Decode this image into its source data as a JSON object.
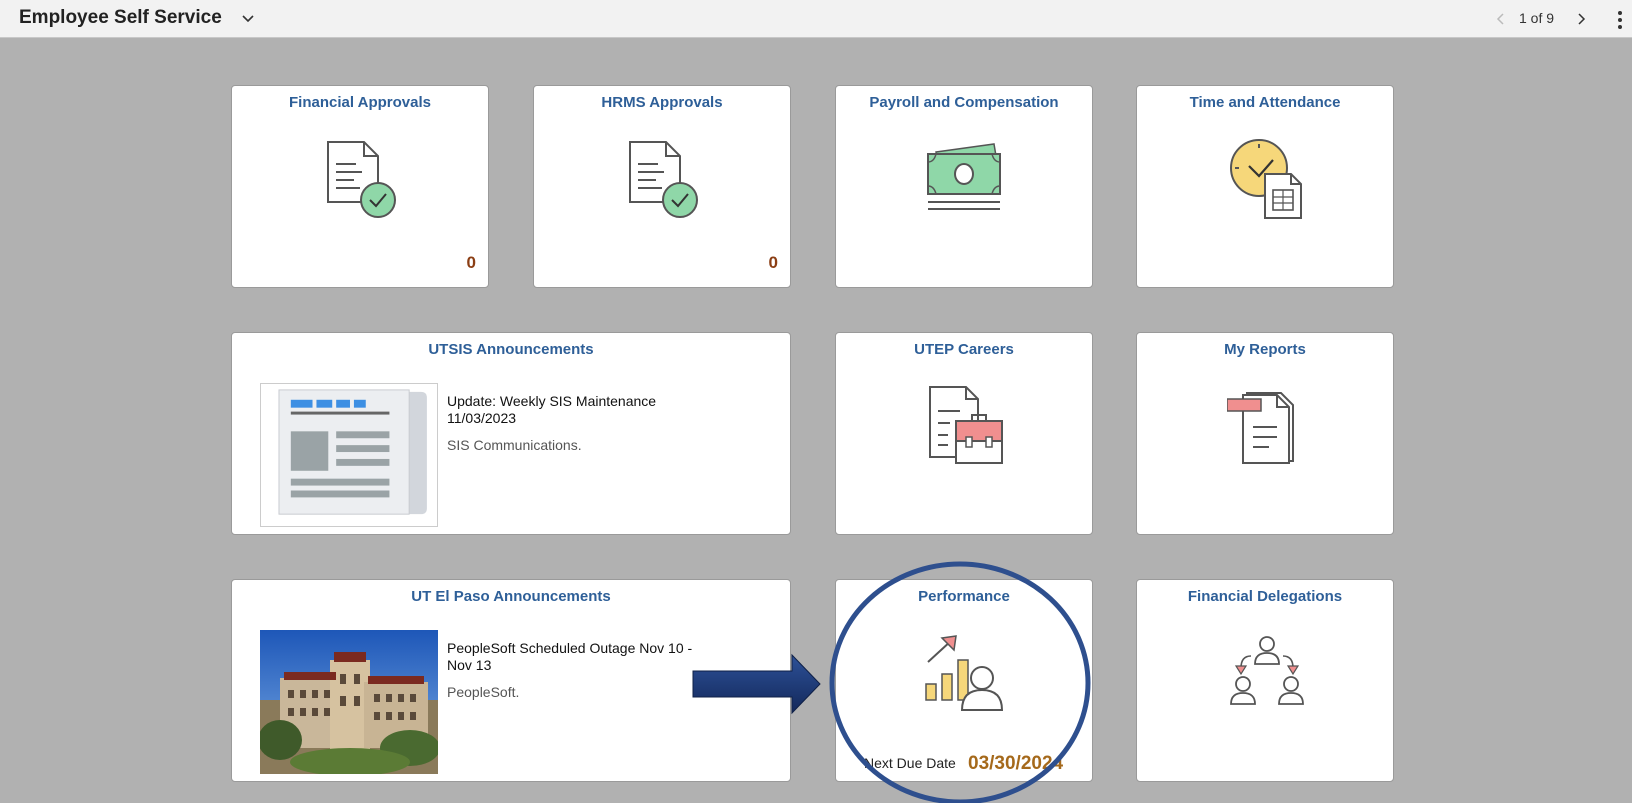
{
  "header": {
    "title": "Employee Self Service",
    "pager": "1 of 9"
  },
  "tiles": {
    "financial_approvals": {
      "title": "Financial Approvals",
      "count": "0"
    },
    "hrms_approvals": {
      "title": "HRMS Approvals",
      "count": "0"
    },
    "payroll": {
      "title": "Payroll and Compensation"
    },
    "time_attendance": {
      "title": "Time and Attendance"
    },
    "utsis": {
      "title": "UTSIS Announcements",
      "news_title": "Update: Weekly SIS Maintenance 11/03/2023",
      "news_sub": "SIS Communications."
    },
    "careers": {
      "title": "UTEP Careers"
    },
    "reports": {
      "title": "My Reports"
    },
    "utep_announcements": {
      "title": "UT El Paso Announcements",
      "news_title": "PeopleSoft Scheduled Outage Nov 10 - Nov 13",
      "news_sub": "PeopleSoft."
    },
    "performance": {
      "title": "Performance",
      "due_label": "Next Due Date",
      "due_value": "03/30/2024"
    },
    "delegations": {
      "title": "Financial Delegations"
    }
  },
  "colors": {
    "tile_title": "#2e5f98",
    "count": "#8b3e14",
    "due_date": "#a5691b",
    "highlight_circle": "#2e4f8e",
    "arrow": "#1f3a6b"
  }
}
